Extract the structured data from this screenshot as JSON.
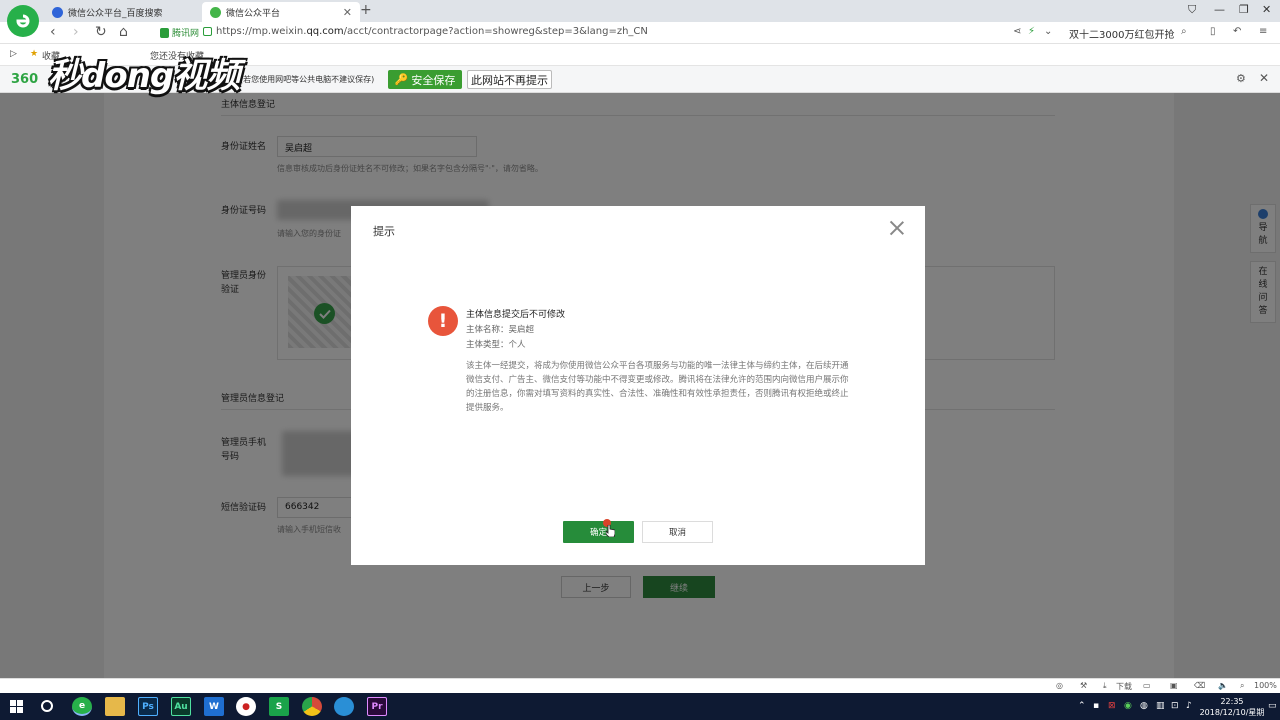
{
  "browser": {
    "tabs": [
      {
        "label": "微信公众平台_百度搜索",
        "close": ""
      },
      {
        "label": "微信公众平台",
        "close": "✕"
      }
    ],
    "new_tab": "+",
    "secure_label": "腾讯网",
    "url_prefix": "https://mp.weixin.",
    "url_domain": "qq.com",
    "url_path": "/acct/contractorpage?action=showreg&step=3&lang=zh_CN",
    "promo": "双十二3000万红包开抢",
    "bookmarks": [
      "收藏",
      "您还没有收藏"
    ]
  },
  "notice360": {
    "brand": "360",
    "hint": "(若您使用网吧等公共电脑不建议保存)",
    "save_label": "安全保存",
    "no_more_label": "此网站不再提示"
  },
  "watermark": "秒dong视频",
  "form": {
    "section_entity": "主体信息登记",
    "id_name_label": "身份证姓名",
    "id_name_value": "吴启超",
    "id_name_help": "信息审核成功后身份证姓名不可修改；如果名字包含分隔号\"·\"，请勿省略。",
    "id_number_label": "身份证号码",
    "id_number_help": "请输入您的身份证",
    "admin_id_label": "管理员身份验证",
    "section_admin": "管理员信息登记",
    "admin_phone_label": "管理员手机号码",
    "sms_label": "短信验证码",
    "sms_value": "666342",
    "sms_help": "请输入手机短信收",
    "prev_label": "上一步",
    "next_label": "继续"
  },
  "side_tools": [
    {
      "label": "导航"
    },
    {
      "label": "在线问答"
    }
  ],
  "modal": {
    "title": "提示",
    "icon_glyph": "!",
    "heading": "主体信息提交后不可修改",
    "entity_name": "主体名称：吴启超",
    "entity_type": "主体类型：个人",
    "body": "该主体一经提交，将成为你使用微信公众平台各项服务与功能的唯一法律主体与缔约主体，在后续开通微信支付、广告主、微信支付等功能中不得变更或修改。腾讯将在法律允许的范围内向微信用户展示你的注册信息，你需对填写资料的真实性、合法性、准确性和有效性承担责任，否则腾讯有权拒绝或终止提供服务。",
    "confirm_label": "确定",
    "cancel_label": "取消"
  },
  "statusbar": {
    "download": "下载",
    "zoom": "100%"
  },
  "taskbar": {
    "apps": [
      {
        "name": "360-browser",
        "glyph": "e",
        "color": "#27b04a"
      },
      {
        "name": "file-explorer",
        "glyph": "",
        "color": "#f0c040"
      },
      {
        "name": "photoshop",
        "glyph": "Ps",
        "color": "#0a2a4a"
      },
      {
        "name": "audition",
        "glyph": "Au",
        "color": "#0a3a2a"
      },
      {
        "name": "word",
        "glyph": "W",
        "color": "#1f6fd1"
      },
      {
        "name": "recorder",
        "glyph": "●",
        "color": "#cc2222"
      },
      {
        "name": "wps",
        "glyph": "S",
        "color": "#1aa34a"
      },
      {
        "name": "chrome",
        "glyph": "",
        "color": "#d64a3a"
      },
      {
        "name": "edge-like",
        "glyph": "",
        "color": "#2a8fd6"
      },
      {
        "name": "premiere",
        "glyph": "Pr",
        "color": "#2a0a3a"
      }
    ],
    "time": "22:35",
    "date": "2018/12/10/星期一"
  },
  "colors": {
    "accent_green": "#268c3a",
    "warning_red": "#e8553b"
  }
}
